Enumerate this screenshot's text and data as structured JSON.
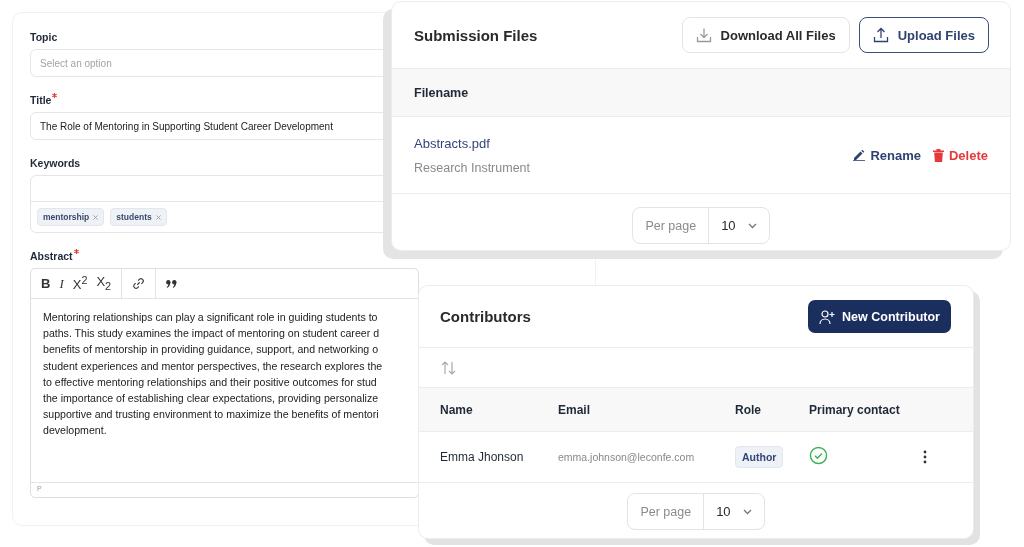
{
  "submission_form": {
    "topic": {
      "label": "Topic",
      "placeholder": "Select an option"
    },
    "title_field": {
      "label": "Title",
      "required": true,
      "value": "The Role of Mentoring in Supporting Student Career Development"
    },
    "keywords": {
      "label": "Keywords",
      "tags": [
        "mentorship",
        "students"
      ]
    },
    "abstract": {
      "label": "Abstract",
      "required": true,
      "toolbar": [
        [
          {
            "kind": "bold",
            "label": "B"
          },
          {
            "kind": "italic",
            "label": "I"
          },
          {
            "kind": "superscript",
            "label": "X$^{2}$"
          },
          {
            "kind": "subscript",
            "label": "X$_{2}$"
          }
        ],
        [
          {
            "kind": "link"
          }
        ],
        [
          {
            "kind": "quote"
          }
        ]
      ],
      "lines": [
        "Mentoring relationships can play a significant role in guiding students to",
        "paths. This study examines the impact of mentoring on student career d",
        "benefits of mentorship in providing guidance, support, and networking o",
        "student experiences and mentor perspectives, the research explores the",
        "to effective mentoring relationships and their positive outcomes for stud",
        "the importance of establishing clear expectations, providing personalize",
        "supportive and trusting environment to maximize the benefits of mentori",
        "development."
      ],
      "status": "P"
    }
  },
  "submission_files": {
    "title": "Submission Files",
    "buttons": [
      {
        "kind": "download",
        "label": "Download All Files"
      },
      {
        "kind": "upload",
        "label": "Upload Files"
      }
    ],
    "columns": [
      "Filename"
    ],
    "rows": [
      {
        "name": "Abstracts.pdf",
        "type": "Research Instrument",
        "actions": [
          {
            "kind": "rename",
            "label": "Rename"
          },
          {
            "kind": "delete",
            "label": "Delete"
          }
        ]
      }
    ],
    "pager": {
      "label": "Per page",
      "value": "10"
    }
  },
  "contributors": {
    "title": "Contributors",
    "button": "New Contributor",
    "columns": [
      "Name",
      "Email",
      "Role",
      "Primary contact"
    ],
    "rows": [
      {
        "name": "Emma Jhonson",
        "email": "emma.johnson@leconfe.com",
        "role": "Author",
        "primary": true
      }
    ],
    "pager": {
      "label": "Per page",
      "value": "10"
    }
  }
}
